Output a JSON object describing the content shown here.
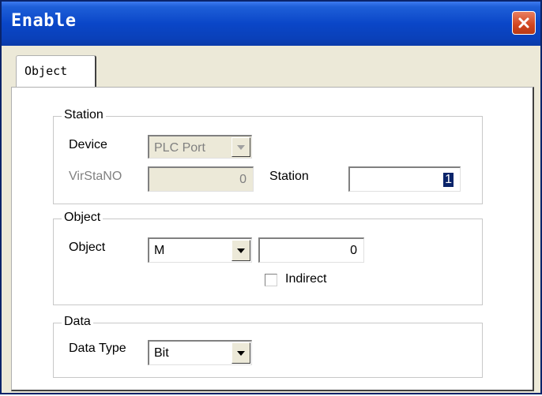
{
  "window": {
    "title": "Enable"
  },
  "tabs": [
    {
      "label": "Object"
    }
  ],
  "station_group": {
    "legend": "Station",
    "device_label": "Device",
    "device_value": "PLC Port",
    "virstano_label": "VirStaNO",
    "virstano_value": "0",
    "station_label": "Station",
    "station_value": "1"
  },
  "object_group": {
    "legend": "Object",
    "object_label": "Object",
    "object_type_value": "M",
    "object_address_value": "0",
    "indirect_label": "Indirect",
    "indirect_checked": false
  },
  "data_group": {
    "legend": "Data",
    "data_type_label": "Data Type",
    "data_type_value": "Bit"
  },
  "icons": {
    "close": "close-icon",
    "dropdown": "chevron-down-icon"
  },
  "colors": {
    "titlebar": "#0a46c8",
    "close": "#d1451f",
    "dialog_bg": "#ece9d8",
    "selection": "#0a246a"
  }
}
